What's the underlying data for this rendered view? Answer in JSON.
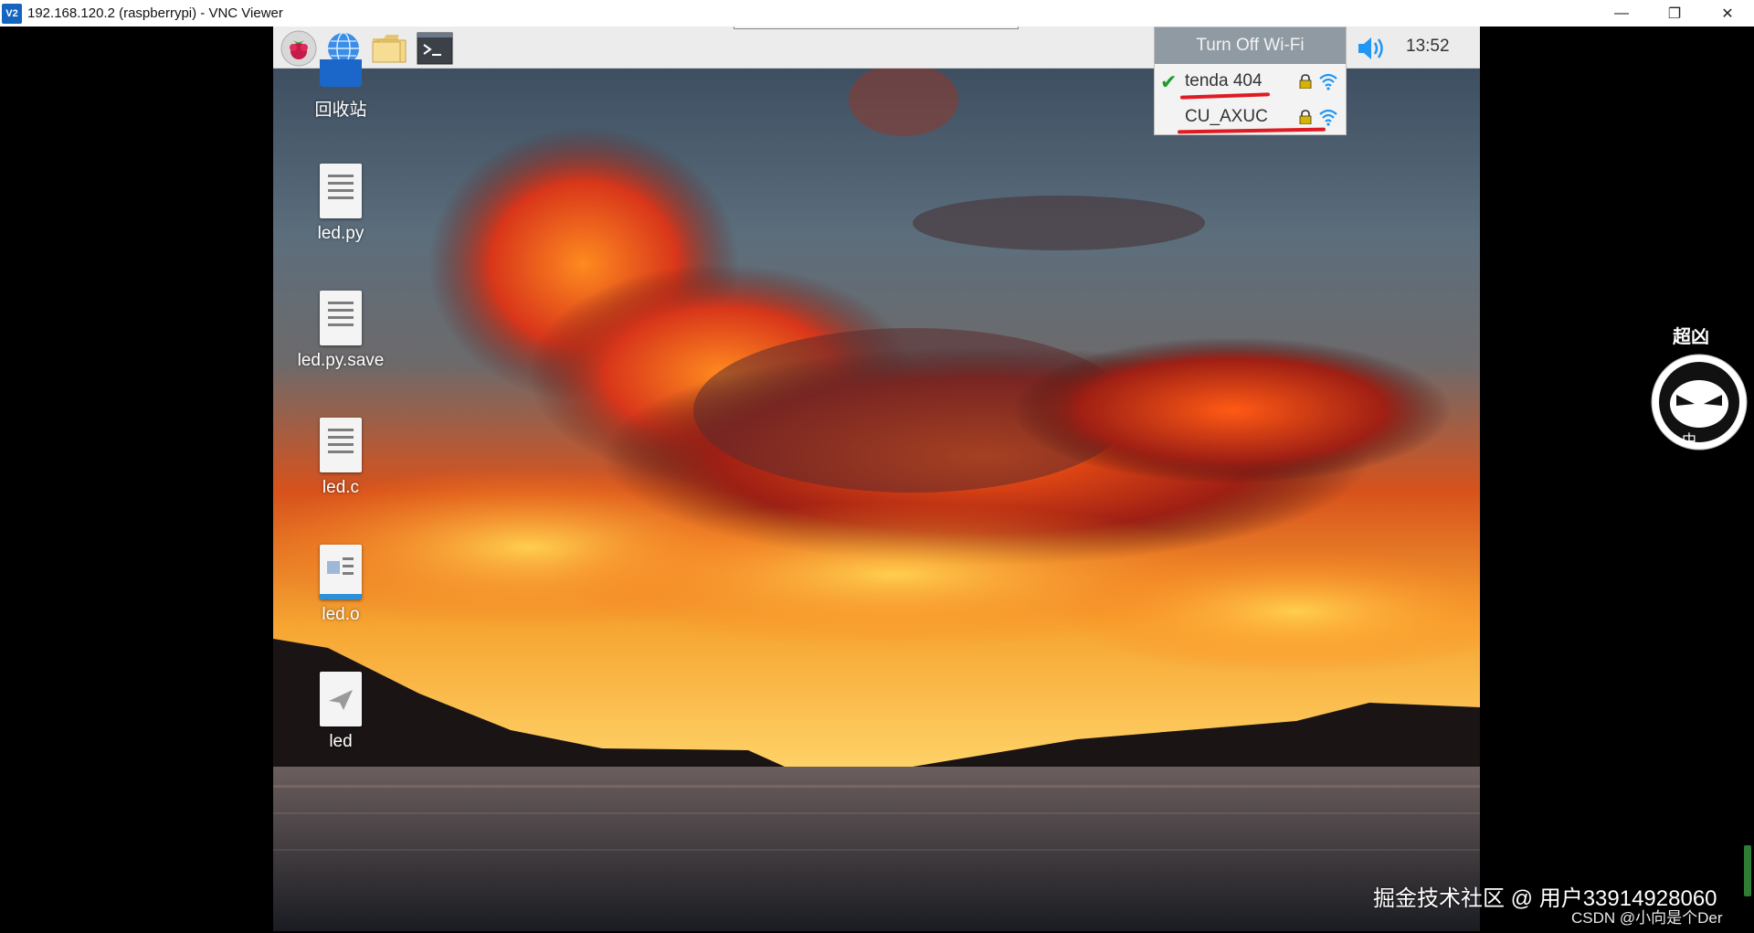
{
  "window": {
    "icon_text": "V2",
    "title": "192.168.120.2 (raspberrypi) - VNC Viewer",
    "controls": [
      "—",
      "❐",
      "✕"
    ]
  },
  "taskbar": {
    "launchers": [
      "raspberry-menu",
      "web-browser",
      "file-manager",
      "terminal"
    ],
    "clock": "13:52"
  },
  "wifi_menu": {
    "header": "Turn Off Wi-Fi",
    "networks": [
      {
        "ssid": "tenda 404",
        "connected": true,
        "secured": true
      },
      {
        "ssid": "CU_AXUC",
        "connected": false,
        "secured": true
      }
    ],
    "annotation_color": "#e01a22"
  },
  "desktop": {
    "items": [
      {
        "label": "回收站",
        "icon": "trash-icon"
      },
      {
        "label": "led.py",
        "icon": "text-file-icon"
      },
      {
        "label": "led.py.save",
        "icon": "text-file-icon"
      },
      {
        "label": "led.c",
        "icon": "text-file-icon"
      },
      {
        "label": "led.o",
        "icon": "object-file-icon"
      },
      {
        "label": "led",
        "icon": "executable-file-icon"
      }
    ]
  },
  "watermark": {
    "main": "掘金技术社区 @ 用户33914928060",
    "sub": "CSDN @小向是个Der"
  },
  "side_logo": {
    "top_text": "超凶",
    "bottom_text": "中"
  },
  "colors": {
    "wifi_menu_header": "#909aa2",
    "connected_check": "#1e9c2a",
    "signal": "#2196f3",
    "lock": "#d4b400"
  }
}
